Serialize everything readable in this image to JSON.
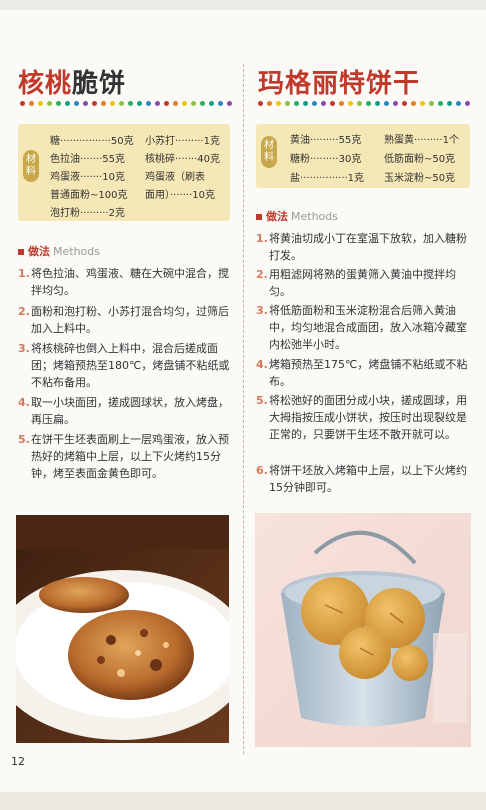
{
  "page_number": "12",
  "colors": {
    "accent_red": "#c0392b",
    "ingredient_bg": "#f6e7b6",
    "tag_gold": "#c8a84a",
    "step_number": "#d27a5b"
  },
  "left": {
    "title_part1": "核桃",
    "title_part2": "脆饼",
    "ingredients_tag": "材料",
    "ingredients": [
      "糖················50克",
      "小苏打·········1克",
      "色拉油·······55克",
      "核桃碎·······40克",
      "鸡蛋液·······10克",
      "鸡蛋液（刷表",
      "普通面粉~100克",
      "面用）·······10克",
      "泡打粉·········2克"
    ],
    "methods_label": "做法",
    "methods_en": "Methods",
    "steps": [
      {
        "n": "1.",
        "text": "将色拉油、鸡蛋液、糖在大碗中混合，搅拌均匀。"
      },
      {
        "n": "2.",
        "text": "面粉和泡打粉、小苏打混合均匀，过筛后加入上料中。"
      },
      {
        "n": "3.",
        "text": "将核桃碎也倒入上料中，混合后搓成面团；烤箱预热至180℃，烤盘铺不粘纸或不粘布备用。"
      },
      {
        "n": "4.",
        "text": "取一小块面团，搓成圆球状，放入烤盘，再压扁。"
      },
      {
        "n": "5.",
        "text": "在饼干生坯表面刷上一层鸡蛋液，放入预热好的烤箱中上层，以上下火烤约15分钟，烤至表面金黄色即可。"
      }
    ]
  },
  "right": {
    "title": "玛格丽特饼干",
    "ingredients_tag": "材料",
    "ingredients": [
      "黄油·········55克",
      "熟蛋黄·········1个",
      "糖粉·········30克",
      "低筋面粉~50克",
      "盐···············1克",
      "玉米淀粉~50克"
    ],
    "methods_label": "做法",
    "methods_en": "Methods",
    "steps": [
      {
        "n": "1.",
        "text": "将黄油切成小丁在室温下放软，加入糖粉打发。"
      },
      {
        "n": "2.",
        "text": "用粗滤网将熟的蛋黄筛入黄油中搅拌均匀。"
      },
      {
        "n": "3.",
        "text": "将低筋面粉和玉米淀粉混合后筛入黄油中，均匀地混合成面团，放入冰箱冷藏室内松弛半小时。"
      },
      {
        "n": "4.",
        "text": "烤箱预热至175℃，烤盘铺不粘纸或不粘布。"
      },
      {
        "n": "5.",
        "text": "将松弛好的面团分成小块，搓成圆球，用大拇指按压成小饼状，按压时出现裂纹是正常的，只要饼干生坯不散开就可以。"
      },
      {
        "n": "6.",
        "text": "将饼干坯放入烤箱中上层，以上下火烤约15分钟即可。"
      }
    ]
  }
}
